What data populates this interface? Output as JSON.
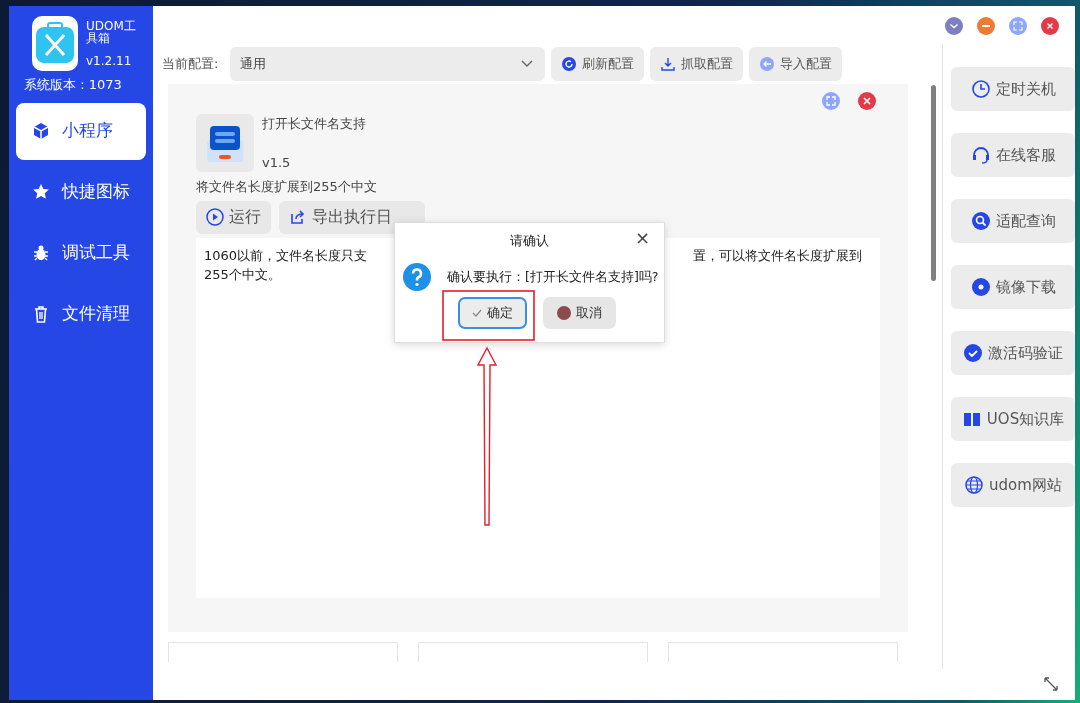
{
  "app": {
    "name": "UDOM工具箱",
    "version": "v1.2.11",
    "system_version": "系统版本 : 1073"
  },
  "sidebar": {
    "items": [
      {
        "label": "小程序",
        "selected": true
      },
      {
        "label": "快捷图标",
        "selected": false
      },
      {
        "label": "调试工具",
        "selected": false
      },
      {
        "label": "文件清理",
        "selected": false
      }
    ]
  },
  "config": {
    "label": "当前配置:",
    "value": "通用",
    "buttons": [
      "刷新配置",
      "抓取配置",
      "导入配置"
    ]
  },
  "program": {
    "title": "打开长文件名支持",
    "version": "v1.5",
    "description": "将文件名长度扩展到255个中文",
    "buttons": [
      "运行",
      "导出执行日"
    ],
    "text_line_1_start": "1060以前，文件名长度只支",
    "text_line_1_end": "置，可以将文件名长度扩展到",
    "text_line_2": "255个中文。"
  },
  "dialog": {
    "title": "请确认",
    "close": "×",
    "message": "确认要执行：[打开长文件名支持]吗?",
    "buttons": [
      {
        "label": "确定",
        "focused": true
      },
      {
        "label": "取消",
        "focused": false
      }
    ]
  },
  "quick_actions": [
    "定时关机",
    "在线客服",
    "适配查询",
    "镜像下载",
    "激活码验证",
    "UOS知识库",
    "udom网站"
  ]
}
